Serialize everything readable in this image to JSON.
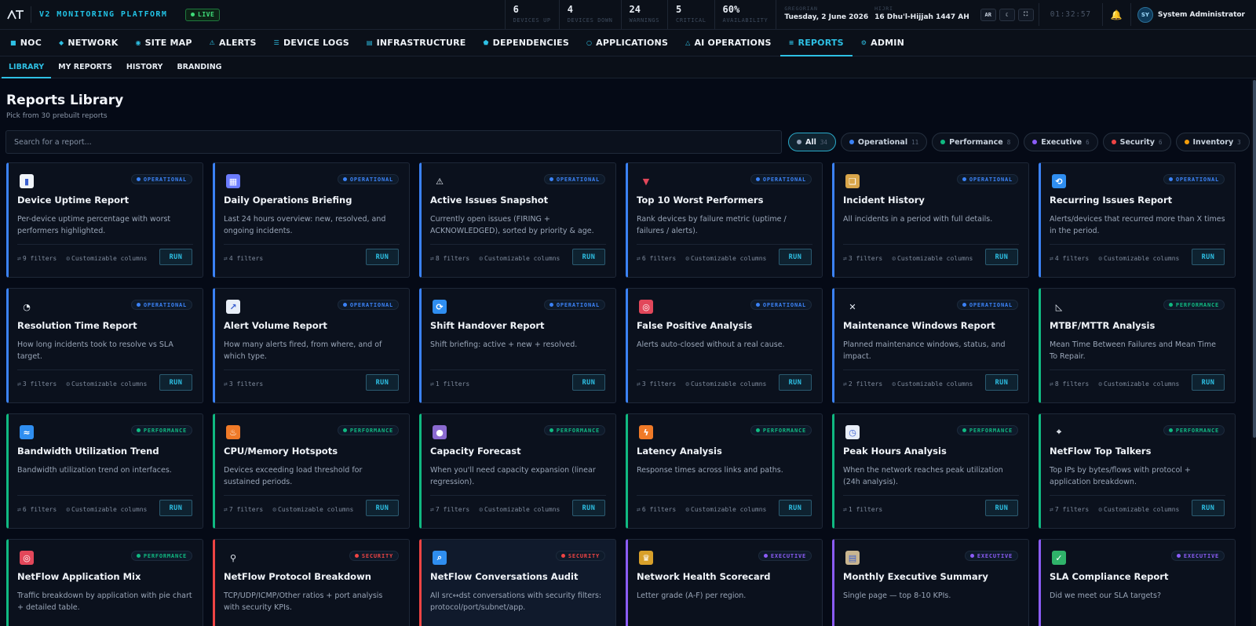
{
  "colors": {
    "accent": "#2ec0e4",
    "operational": "#3b82f6",
    "performance": "#10b981",
    "executive": "#8b5cf6",
    "security": "#ef4444",
    "inventory": "#f59e0b",
    "all": "#94a3b8"
  },
  "header": {
    "brand": "V2 MONITORING PLATFORM",
    "live_label": "LIVE",
    "stats": [
      {
        "value": "6",
        "label": "DEVICES UP"
      },
      {
        "value": "4",
        "label": "DEVICES DOWN"
      },
      {
        "value": "24",
        "label": "WARNINGS"
      },
      {
        "value": "5",
        "label": "CRITICAL"
      },
      {
        "value": "60%",
        "label": "AVAILABILITY"
      }
    ],
    "gregorian_label": "GREGORIAN",
    "gregorian_date": "Tuesday, 2 June 2026",
    "hijri_label": "HIJRI",
    "hijri_date": "16 Dhu'l-Hijjah 1447 AH",
    "lang_button": "AR",
    "clock": "01:32:57",
    "user_initials": "SY",
    "user_name": "System Administrator"
  },
  "nav": [
    {
      "label": "NOC",
      "icon": "■",
      "active": false
    },
    {
      "label": "NETWORK",
      "icon": "◆",
      "active": false
    },
    {
      "label": "SITE MAP",
      "icon": "◉",
      "active": false
    },
    {
      "label": "ALERTS",
      "icon": "⚠",
      "active": false
    },
    {
      "label": "DEVICE LOGS",
      "icon": "☰",
      "active": false
    },
    {
      "label": "INFRASTRUCTURE",
      "icon": "▤",
      "active": false
    },
    {
      "label": "DEPENDENCIES",
      "icon": "⬟",
      "active": false
    },
    {
      "label": "APPLICATIONS",
      "icon": "○",
      "active": false
    },
    {
      "label": "AI OPERATIONS",
      "icon": "△",
      "active": false
    },
    {
      "label": "REPORTS",
      "icon": "≡",
      "active": true
    },
    {
      "label": "ADMIN",
      "icon": "⚙",
      "active": false
    }
  ],
  "subnav": [
    {
      "label": "LIBRARY",
      "active": true
    },
    {
      "label": "MY REPORTS",
      "active": false
    },
    {
      "label": "HISTORY",
      "active": false
    },
    {
      "label": "BRANDING",
      "active": false
    }
  ],
  "page": {
    "title": "Reports Library",
    "subtitle": "Pick from 30 prebuilt reports",
    "search_placeholder": "Search for a report..."
  },
  "filters": [
    {
      "label": "All",
      "count": "34",
      "category": "all",
      "active": true
    },
    {
      "label": "Operational",
      "count": "11",
      "category": "operational",
      "active": false
    },
    {
      "label": "Performance",
      "count": "8",
      "category": "performance",
      "active": false
    },
    {
      "label": "Executive",
      "count": "6",
      "category": "executive",
      "active": false
    },
    {
      "label": "Security",
      "count": "6",
      "category": "security",
      "active": false
    },
    {
      "label": "Inventory",
      "count": "3",
      "category": "inventory",
      "active": false
    }
  ],
  "reports": [
    {
      "title": "Device Uptime Report",
      "desc": "Per-device uptime percentage with worst performers highlighted.",
      "category": "operational",
      "badge": "OPERATIONAL",
      "filters": "9 filters",
      "custom": "Customizable columns",
      "run": "RUN",
      "icon": "bar-chart-icon",
      "glyph": "▮",
      "icon_bg": "#f0f4f9"
    },
    {
      "title": "Daily Operations Briefing",
      "desc": "Last 24 hours overview: new, resolved, and ongoing incidents.",
      "category": "operational",
      "badge": "OPERATIONAL",
      "filters": "4 filters",
      "custom": "",
      "run": "RUN",
      "icon": "calendar-icon",
      "glyph": "▦",
      "icon_bg": "#6b7cff"
    },
    {
      "title": "Active Issues Snapshot",
      "desc": "Currently open issues (FIRING + ACKNOWLEDGED), sorted by priority & age.",
      "category": "operational",
      "badge": "OPERATIONAL",
      "filters": "8 filters",
      "custom": "Customizable columns",
      "run": "RUN",
      "icon": "warning-icon",
      "glyph": "⚠",
      "icon_bg": "transparent"
    },
    {
      "title": "Top 10 Worst Performers",
      "desc": "Rank devices by failure metric (uptime / failures / alerts).",
      "category": "operational",
      "badge": "OPERATIONAL",
      "filters": "6 filters",
      "custom": "Customizable columns",
      "run": "RUN",
      "icon": "down-triangle-icon",
      "glyph": "▼",
      "icon_bg": "transparent"
    },
    {
      "title": "Incident History",
      "desc": "All incidents in a period with full details.",
      "category": "operational",
      "badge": "OPERATIONAL",
      "filters": "3 filters",
      "custom": "Customizable columns",
      "run": "RUN",
      "icon": "scroll-icon",
      "glyph": "❏",
      "icon_bg": "#d8a54a"
    },
    {
      "title": "Recurring Issues Report",
      "desc": "Alerts/devices that recurred more than X times in the period.",
      "category": "operational",
      "badge": "OPERATIONAL",
      "filters": "4 filters",
      "custom": "Customizable columns",
      "run": "RUN",
      "icon": "repeat-icon",
      "glyph": "⟲",
      "icon_bg": "#2f8ef0"
    },
    {
      "title": "Resolution Time Report",
      "desc": "How long incidents took to resolve vs SLA target.",
      "category": "operational",
      "badge": "OPERATIONAL",
      "filters": "3 filters",
      "custom": "Customizable columns",
      "run": "RUN",
      "icon": "stopwatch-icon",
      "glyph": "◔",
      "icon_bg": "transparent"
    },
    {
      "title": "Alert Volume Report",
      "desc": "How many alerts fired, from where, and of which type.",
      "category": "operational",
      "badge": "OPERATIONAL",
      "filters": "3 filters",
      "custom": "",
      "run": "RUN",
      "icon": "line-chart-icon",
      "glyph": "↗",
      "icon_bg": "#e8eef8"
    },
    {
      "title": "Shift Handover Report",
      "desc": "Shift briefing: active + new + resolved.",
      "category": "operational",
      "badge": "OPERATIONAL",
      "filters": "1 filters",
      "custom": "",
      "run": "RUN",
      "icon": "refresh-icon",
      "glyph": "⟳",
      "icon_bg": "#2f8ef0"
    },
    {
      "title": "False Positive Analysis",
      "desc": "Alerts auto-closed without a real cause.",
      "category": "operational",
      "badge": "OPERATIONAL",
      "filters": "3 filters",
      "custom": "Customizable columns",
      "run": "RUN",
      "icon": "target-icon",
      "glyph": "◎",
      "icon_bg": "#e2475a"
    },
    {
      "title": "Maintenance Windows Report",
      "desc": "Planned maintenance windows, status, and impact.",
      "category": "operational",
      "badge": "OPERATIONAL",
      "filters": "2 filters",
      "custom": "Customizable columns",
      "run": "RUN",
      "icon": "tools-icon",
      "glyph": "✕",
      "icon_bg": "transparent"
    },
    {
      "title": "MTBF/MTTR Analysis",
      "desc": "Mean Time Between Failures and Mean Time To Repair.",
      "category": "performance",
      "badge": "PERFORMANCE",
      "filters": "8 filters",
      "custom": "Customizable columns",
      "run": "RUN",
      "icon": "triangle-ruler-icon",
      "glyph": "◺",
      "icon_bg": "transparent"
    },
    {
      "title": "Bandwidth Utilization Trend",
      "desc": "Bandwidth utilization trend on interfaces.",
      "category": "performance",
      "badge": "PERFORMANCE",
      "filters": "6 filters",
      "custom": "Customizable columns",
      "run": "RUN",
      "icon": "wave-icon",
      "glyph": "≈",
      "icon_bg": "#2f8ef0"
    },
    {
      "title": "CPU/Memory Hotspots",
      "desc": "Devices exceeding load threshold for sustained periods.",
      "category": "performance",
      "badge": "PERFORMANCE",
      "filters": "7 filters",
      "custom": "Customizable columns",
      "run": "RUN",
      "icon": "fire-icon",
      "glyph": "♨",
      "icon_bg": "#f07a28"
    },
    {
      "title": "Capacity Forecast",
      "desc": "When you'll need capacity expansion (linear regression).",
      "category": "performance",
      "badge": "PERFORMANCE",
      "filters": "7 filters",
      "custom": "Customizable columns",
      "run": "RUN",
      "icon": "crystal-ball-icon",
      "glyph": "●",
      "icon_bg": "#8a6ad0"
    },
    {
      "title": "Latency Analysis",
      "desc": "Response times across links and paths.",
      "category": "performance",
      "badge": "PERFORMANCE",
      "filters": "6 filters",
      "custom": "Customizable columns",
      "run": "RUN",
      "icon": "lightning-icon",
      "glyph": "ϟ",
      "icon_bg": "#f07a28"
    },
    {
      "title": "Peak Hours Analysis",
      "desc": "When the network reaches peak utilization (24h analysis).",
      "category": "performance",
      "badge": "PERFORMANCE",
      "filters": "1 filters",
      "custom": "",
      "run": "RUN",
      "icon": "clock-icon",
      "glyph": "◷",
      "icon_bg": "#e8eef8"
    },
    {
      "title": "NetFlow Top Talkers",
      "desc": "Top IPs by bytes/flows with protocol + application breakdown.",
      "category": "performance",
      "badge": "PERFORMANCE",
      "filters": "7 filters",
      "custom": "Customizable columns",
      "run": "RUN",
      "icon": "satellite-icon",
      "glyph": "⌖",
      "icon_bg": "transparent"
    },
    {
      "title": "NetFlow Application Mix",
      "desc": "Traffic breakdown by application with pie chart + detailed table.",
      "category": "performance",
      "badge": "PERFORMANCE",
      "filters": "",
      "custom": "",
      "run": "RUN",
      "icon": "target-icon",
      "glyph": "◎",
      "icon_bg": "#e2475a"
    },
    {
      "title": "NetFlow Protocol Breakdown",
      "desc": "TCP/UDP/ICMP/Other ratios + port analysis with security KPIs.",
      "category": "security",
      "badge": "SECURITY",
      "filters": "",
      "custom": "",
      "run": "RUN",
      "icon": "microscope-icon",
      "glyph": "⚲",
      "icon_bg": "transparent"
    },
    {
      "title": "NetFlow Conversations Audit",
      "desc": "All src↔dst conversations with security filters: protocol/port/subnet/app.",
      "category": "security",
      "badge": "SECURITY",
      "filters": "",
      "custom": "",
      "run": "RUN",
      "icon": "magnifier-icon",
      "glyph": "⌕",
      "icon_bg": "#2f8ef0"
    },
    {
      "title": "Network Health Scorecard",
      "desc": "Letter grade (A-F) per region.",
      "category": "executive",
      "badge": "EXECUTIVE",
      "filters": "",
      "custom": "",
      "run": "RUN",
      "icon": "trophy-icon",
      "glyph": "♛",
      "icon_bg": "#d8a02a"
    },
    {
      "title": "Monthly Executive Summary",
      "desc": "Single page — top 8-10 KPIs.",
      "category": "executive",
      "badge": "EXECUTIVE",
      "filters": "",
      "custom": "",
      "run": "RUN",
      "icon": "clipboard-icon",
      "glyph": "▤",
      "icon_bg": "#c9b58f"
    },
    {
      "title": "SLA Compliance Report",
      "desc": "Did we meet our SLA targets?",
      "category": "executive",
      "badge": "EXECUTIVE",
      "filters": "",
      "custom": "",
      "run": "RUN",
      "icon": "check-icon",
      "glyph": "✓",
      "icon_bg": "#2fb36a"
    }
  ]
}
